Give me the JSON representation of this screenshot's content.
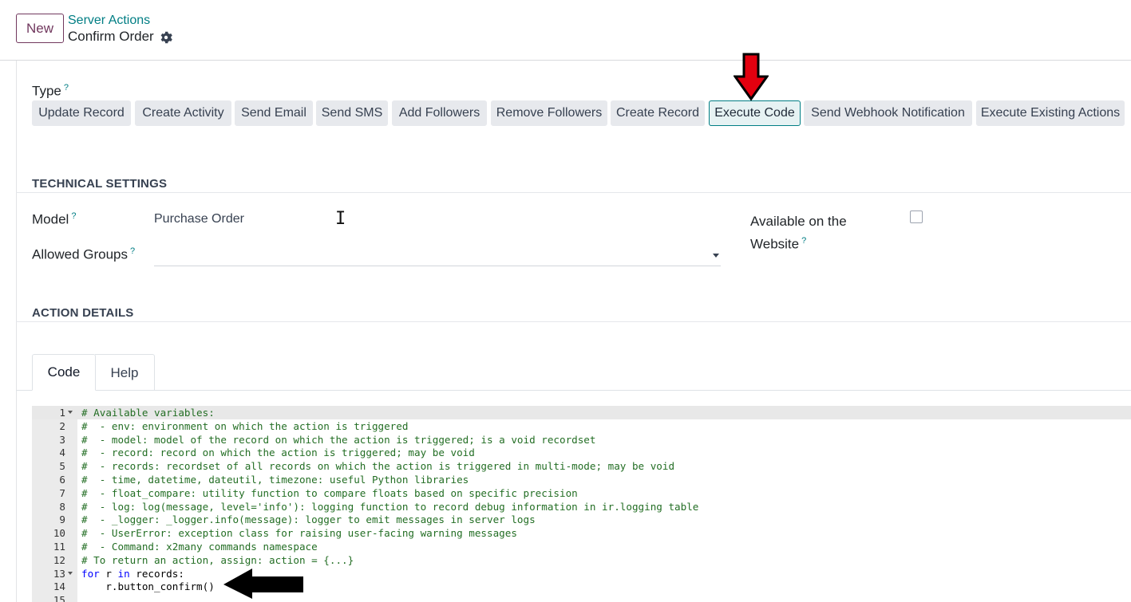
{
  "header": {
    "new_label": "New",
    "breadcrumb": "Server Actions",
    "record_title": "Confirm Order",
    "settings_icon": "gear-icon"
  },
  "type_field": {
    "label": "Type",
    "help": "?",
    "options": [
      "Update Record",
      "Create Activity",
      "Send Email",
      "Send SMS",
      "Add Followers",
      "Remove Followers",
      "Create Record",
      "Execute Code",
      "Send Webhook Notification",
      "Execute Existing Actions"
    ],
    "selected": "Execute Code"
  },
  "technical": {
    "title": "TECHNICAL SETTINGS",
    "model_label": "Model",
    "model_help": "?",
    "model_value": "Purchase Order",
    "groups_label": "Allowed Groups",
    "groups_help": "?",
    "groups_value": "",
    "website_label_1": "Available on the",
    "website_label_2": "Website",
    "website_help": "?",
    "website_checked": false
  },
  "action_details": {
    "title": "ACTION DETAILS",
    "tabs": [
      "Code",
      "Help"
    ],
    "active_tab": "Code"
  },
  "code": {
    "lines": [
      "# Available variables:",
      "#  - env: environment on which the action is triggered",
      "#  - model: model of the record on which the action is triggered; is a void recordset",
      "#  - record: record on which the action is triggered; may be void",
      "#  - records: recordset of all records on which the action is triggered in multi-mode; may be void",
      "#  - time, datetime, dateutil, timezone: useful Python libraries",
      "#  - float_compare: utility function to compare floats based on specific precision",
      "#  - log: log(message, level='info'): logging function to record debug information in ir.logging table",
      "#  - _logger: _logger.info(message): logger to emit messages in server logs",
      "#  - UserError: exception class for raising user-facing warning messages",
      "#  - Command: x2many commands namespace",
      "# To return an action, assign: action = {...}",
      "for r in records:",
      "    r.button_confirm()",
      ""
    ],
    "line_numbers": [
      "1",
      "2",
      "3",
      "4",
      "5",
      "6",
      "7",
      "8",
      "9",
      "10",
      "11",
      "12",
      "13",
      "14",
      "15"
    ]
  },
  "colors": {
    "accent": "#017e84",
    "brand": "#71385e",
    "comment": "#236e24",
    "keyword": "#0000ff",
    "annotation_arrow_red": "#e3000f"
  }
}
